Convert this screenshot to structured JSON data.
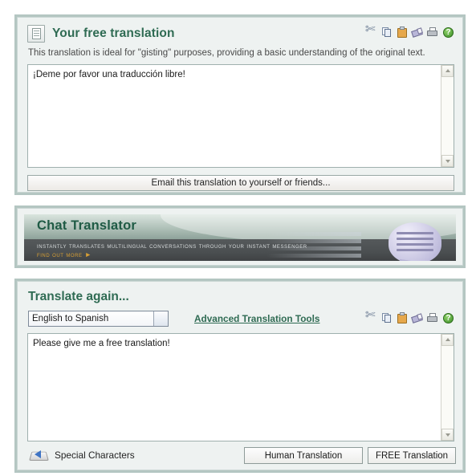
{
  "result_panel": {
    "title": "Your free translation",
    "description": "This translation is ideal for \"gisting\" purposes, providing a basic understanding of the original text.",
    "doc_icon": "document-icon",
    "translated_text": "¡Deme por favor una traducción libre!",
    "email_button": "Email this translation to yourself or friends...",
    "toolbar": [
      {
        "name": "cut-icon",
        "label": "Cut"
      },
      {
        "name": "copy-icon",
        "label": "Copy"
      },
      {
        "name": "paste-icon",
        "label": "Paste"
      },
      {
        "name": "erase-icon",
        "label": "Erase"
      },
      {
        "name": "print-icon",
        "label": "Print"
      },
      {
        "name": "help-icon",
        "label": "Help"
      }
    ]
  },
  "banner": {
    "title": "Chat Translator",
    "tagline": "Instantly translates multilingual conversations through your instant messenger",
    "more_link": "Find out more ►"
  },
  "again_panel": {
    "title": "Translate again...",
    "language_pair": "English to Spanish",
    "advanced_link": "Advanced Translation Tools",
    "source_text": "Please give me a free translation!",
    "special_characters": "Special Characters",
    "human_button": "Human Translation",
    "free_button": "FREE Translation",
    "toolbar": [
      {
        "name": "cut-icon",
        "label": "Cut"
      },
      {
        "name": "copy-icon",
        "label": "Copy"
      },
      {
        "name": "paste-icon",
        "label": "Paste"
      },
      {
        "name": "erase-icon",
        "label": "Erase"
      },
      {
        "name": "print-icon",
        "label": "Print"
      },
      {
        "name": "help-icon",
        "label": "Help"
      }
    ]
  },
  "colors": {
    "panel_frame": "#b4c6c2",
    "panel_bg": "#eef2f1",
    "heading_green": "#2f6b53",
    "banner_dark": "#4b4f51",
    "gold_link": "#d79f35"
  }
}
